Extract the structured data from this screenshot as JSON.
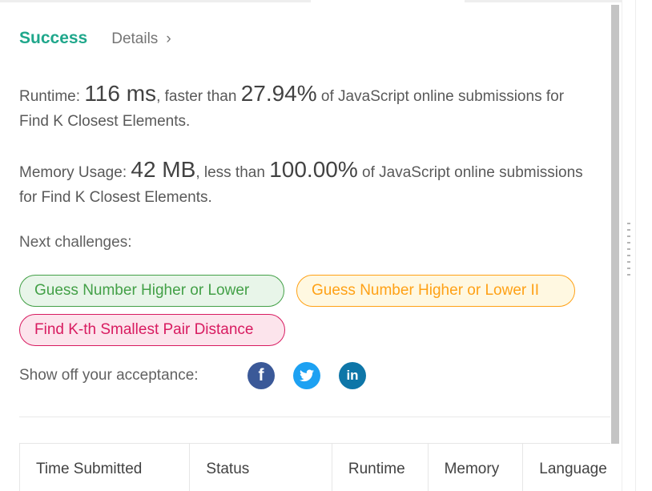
{
  "header": {
    "status": "Success",
    "details_label": "Details",
    "details_chevron": "›"
  },
  "runtime": {
    "prefix": "Runtime: ",
    "value": "116 ms",
    "middle": ", faster than ",
    "percent": "27.94%",
    "suffix_line1": " of JavaScript online submissions for",
    "line2": "Find K Closest Elements."
  },
  "memory": {
    "prefix": "Memory Usage: ",
    "value": "42 MB",
    "middle": ", less than ",
    "percent": "100.00%",
    "suffix_line1": " of JavaScript online submissions",
    "line2": "for Find K Closest Elements."
  },
  "next_challenges": {
    "label": "Next challenges:",
    "items": [
      {
        "label": "Guess Number Higher or Lower",
        "difficulty": "easy",
        "color": "#43a047"
      },
      {
        "label": "Guess Number Higher or Lower II",
        "difficulty": "medium",
        "color": "#ffa116"
      },
      {
        "label": "Find K-th Smallest Pair Distance",
        "difficulty": "hard",
        "color": "#d81b60"
      }
    ]
  },
  "share": {
    "label": "Show off your acceptance:",
    "icons": [
      {
        "name": "facebook-icon",
        "glyph": "f",
        "color": "#3b5998"
      },
      {
        "name": "twitter-icon",
        "glyph": "",
        "color": "#1da1f2"
      },
      {
        "name": "linkedin-icon",
        "glyph": "in",
        "color": "#0e76a8"
      }
    ]
  },
  "table": {
    "columns": [
      "Time Submitted",
      "Status",
      "Runtime",
      "Memory",
      "Language"
    ]
  }
}
